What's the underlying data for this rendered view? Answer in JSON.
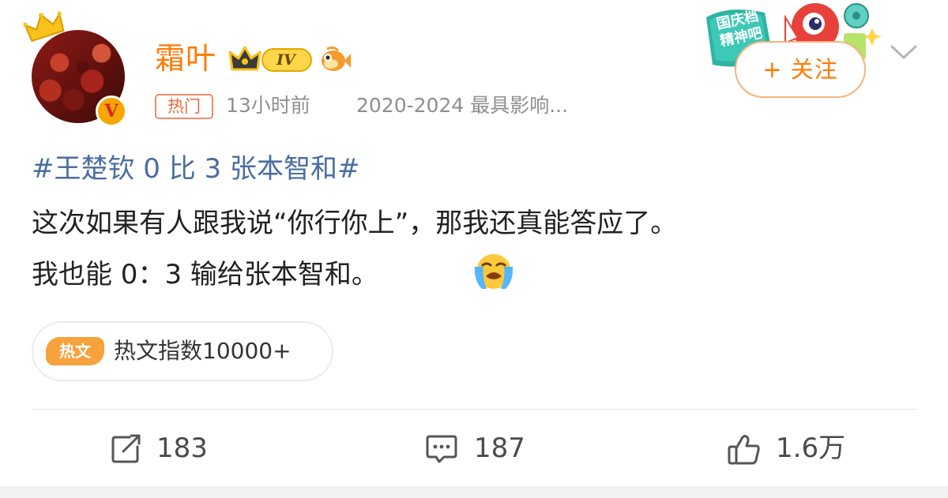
{
  "author": {
    "name": "霜叶",
    "level": "IV",
    "verified_mark": "V"
  },
  "meta": {
    "tag": "热门",
    "time": "13小时前",
    "source": "2020-2024 最具影响..."
  },
  "header": {
    "holiday_banner": "国庆档 精神吧",
    "follow_label": "+ 关注"
  },
  "post": {
    "hashtag": "#王楚钦 0 比 3 张本智和#",
    "line1": "这次如果有人跟我说“你行你上”，那我还真能答应了。",
    "line2": "我也能 0：3 输给张本智和。"
  },
  "hot_index": {
    "badge": "热文",
    "text": "热文指数10000+"
  },
  "actions": {
    "reposts": "183",
    "comments": "187",
    "likes": "1.6万"
  },
  "icons": {
    "crown": "crown-icon",
    "verified": "verified-v-icon",
    "level": "level-crown-badge-icon",
    "fish": "fish-icon",
    "more": "chevron-down-icon",
    "emoji": "crying-emoji-icon",
    "repost": "repost-icon",
    "comment": "comment-icon",
    "like": "thumbs-up-icon"
  },
  "colors": {
    "accent": "#ff7a00",
    "link": "#4a6da0",
    "meta": "#8e8e8e",
    "hot": "#f7a23c"
  }
}
